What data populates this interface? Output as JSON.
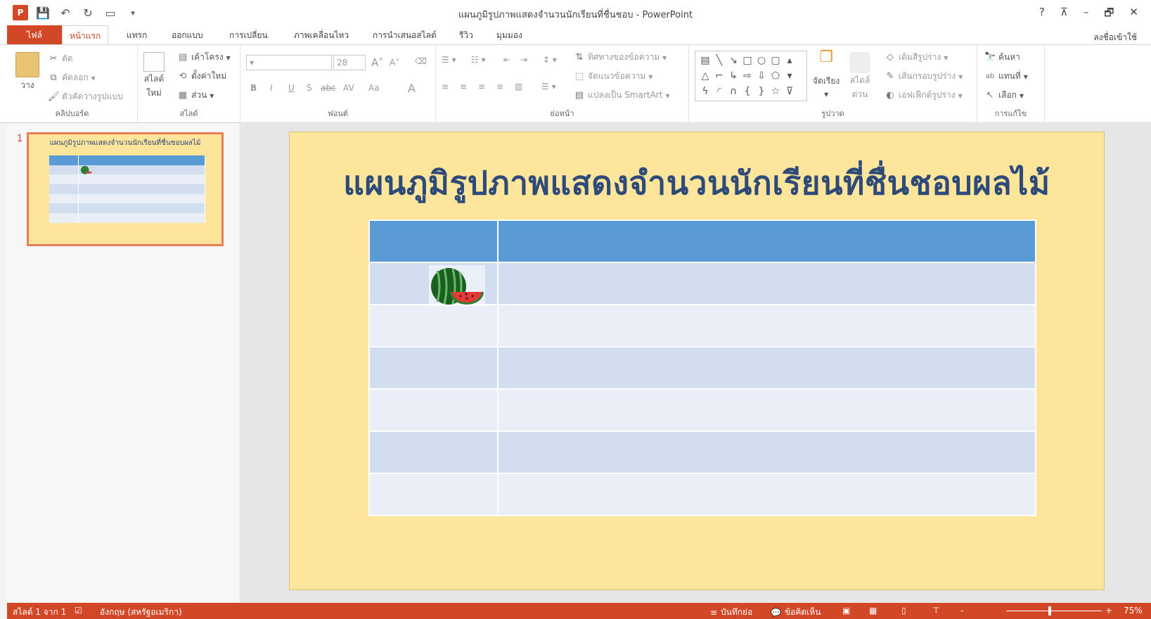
{
  "window": {
    "title": "แผนภูมิรูปภาพแสดงจำนวนนักเรียนที่ชื่นชอบ - PowerPoint",
    "app_logo": "P",
    "help": "?",
    "controls": [
      "⊼",
      "–",
      "🗗",
      "✕"
    ]
  },
  "tabs": {
    "file": "ไฟล์",
    "items": [
      "หน้าแรก",
      "แทรก",
      "ออกแบบ",
      "การเปลี่ยน",
      "ภาพเคลื่อนไหว",
      "การนำเสนอสไลด์",
      "รีวิว",
      "มุมมอง"
    ],
    "active": "หน้าแรก",
    "signin": "ลงชื่อเข้าใช้"
  },
  "ribbon": {
    "clipboard": {
      "label": "คลิปบอร์ด",
      "paste": "วาง",
      "cut": "ตัด",
      "copy": "คัดลอก",
      "format_painter": "ตัวคัดวางรูปแบบ"
    },
    "slides": {
      "label": "สไลด์",
      "new_slide_1": "สไลด์",
      "new_slide_2": "ใหม่",
      "layout": "เค้าโครง",
      "reset": "ตั้งค่าใหม่",
      "section": "ส่วน"
    },
    "font": {
      "label": "ฟอนต์",
      "size": "28",
      "bold": "B",
      "italic": "I",
      "underline": "U",
      "shadow": "S",
      "strike": "abc",
      "spacing": "AV",
      "case": "Aa",
      "color": "A"
    },
    "paragraph": {
      "label": "ย่อหน้า",
      "text_direction": "ทิศทางของข้อความ",
      "align_text": "จัดแนวข้อความ",
      "smartart": "แปลงเป็น SmartArt"
    },
    "drawing": {
      "label": "รูปวาด",
      "arrange": "จัดเรียง",
      "quick_styles_1": "สไตล์",
      "quick_styles_2": "ด่วน",
      "fill": "เติมสีรูปร่าง",
      "outline": "เส้นกรอบรูปร่าง",
      "effects": "เอฟเฟ็กต์รูปร่าง"
    },
    "editing": {
      "label": "การแก้ไข",
      "find": "ค้นหา",
      "replace": "แทนที่",
      "select": "เลือก"
    }
  },
  "thumbnail": {
    "number": "1",
    "title": "แผนภูมิรูปภาพแสดงจำนวนนักเรียนที่ชื่นชอบผลไม้"
  },
  "slide": {
    "title": "แผนภูมิรูปภาพแสดงจำนวนนักเรียนที่ชื่นชอบผลไม้",
    "background": "#fde59b",
    "title_color": "#2e4a78",
    "table_rows": 7,
    "table_header_color": "#5b9bd5"
  },
  "status": {
    "slide_info": "สไลด์ 1 จาก 1",
    "language": "อังกฤษ (สหรัฐอเมริกา)",
    "notes": "บันทึกย่อ",
    "comments": "ข้อคิดเห็น",
    "zoom": "75%",
    "zoom_minus": "-",
    "zoom_plus": "+"
  }
}
